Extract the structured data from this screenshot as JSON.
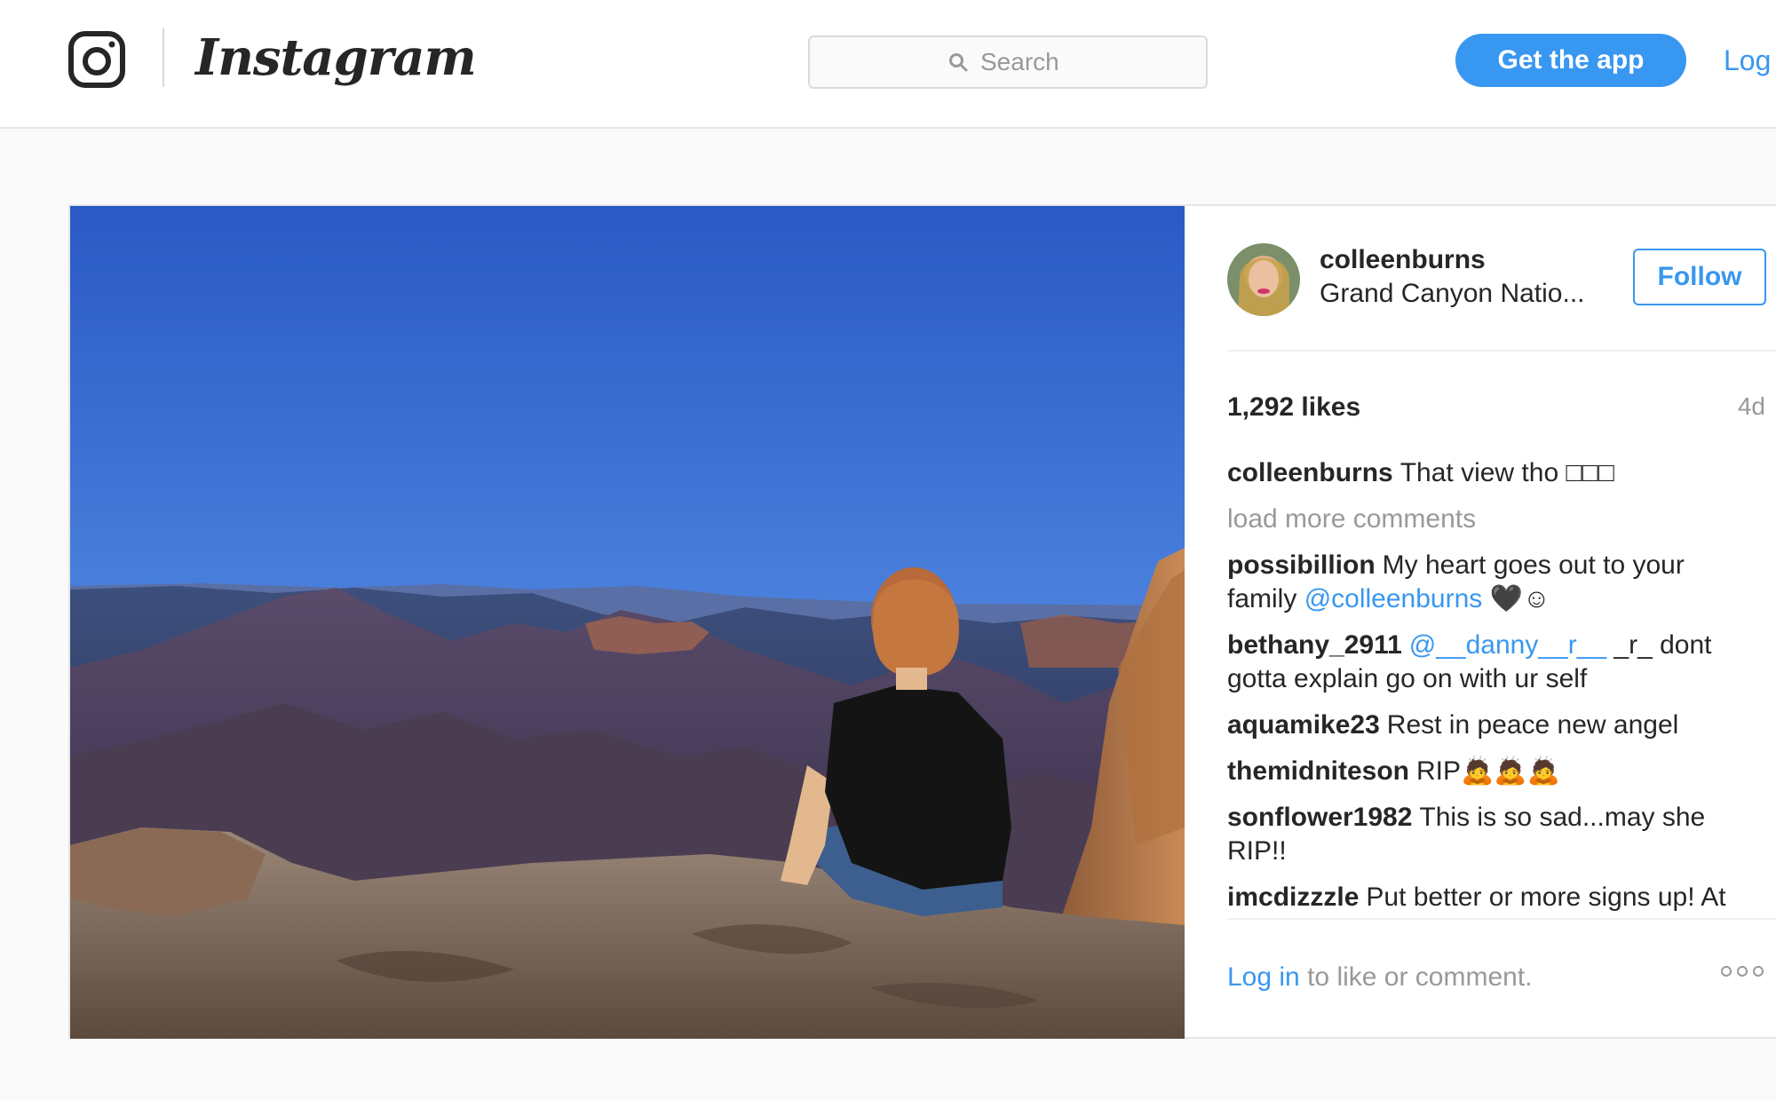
{
  "header": {
    "logo_wordmark": "Instagram",
    "search_placeholder": "Search",
    "get_app_label": "Get the app",
    "login_label": "Log"
  },
  "post": {
    "author": "colleenburns",
    "location": "Grand Canyon Natio...",
    "follow_label": "Follow",
    "likes": "1,292 likes",
    "age": "4d",
    "caption_user": "colleenburns",
    "caption_text": "That view tho □□□",
    "load_more_label": "load more comments",
    "comments": [
      {
        "user": "possibillion",
        "text": "My heart goes out to your family ",
        "mention": "@colleenburns",
        "tail": " 🖤☺"
      },
      {
        "user": "bethany_2911",
        "text": "",
        "mention": "@__danny__r__",
        "tail": " _r_ dont gotta explain go on with ur self"
      },
      {
        "user": "aquamike23",
        "text": "Rest in peace new angel",
        "mention": "",
        "tail": ""
      },
      {
        "user": "themidniteson",
        "text": "RIP🙇🙇🙇",
        "mention": "",
        "tail": ""
      },
      {
        "user": "sonflower1982",
        "text": "This is so sad...may she RIP!!",
        "mention": "",
        "tail": ""
      },
      {
        "user": "imcdizzzle",
        "text": "Put better or more signs up! At",
        "mention": "",
        "tail": ""
      }
    ],
    "login_prompt_link": "Log in",
    "login_prompt_text": " to like or comment."
  },
  "colors": {
    "accent": "#3897f0",
    "text": "#262626",
    "muted": "#999999",
    "border": "#e6e6e6"
  },
  "icons": {
    "logo": "instagram-camera-icon",
    "search": "search-icon",
    "more": "more-options-icon"
  }
}
